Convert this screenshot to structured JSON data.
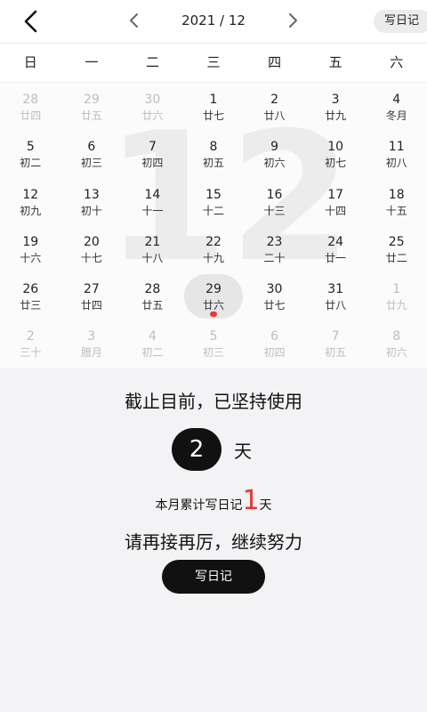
{
  "header": {
    "month_title": "2021 / 12",
    "write_diary_label": "写日记"
  },
  "weekdays": [
    "日",
    "一",
    "二",
    "三",
    "四",
    "五",
    "六"
  ],
  "calendar": {
    "background_number": "12",
    "days": [
      {
        "d": "28",
        "l": "廿四",
        "other": true
      },
      {
        "d": "29",
        "l": "廿五",
        "other": true
      },
      {
        "d": "30",
        "l": "廿六",
        "other": true
      },
      {
        "d": "1",
        "l": "廿七"
      },
      {
        "d": "2",
        "l": "廿八"
      },
      {
        "d": "3",
        "l": "廿九"
      },
      {
        "d": "4",
        "l": "冬月"
      },
      {
        "d": "5",
        "l": "初二"
      },
      {
        "d": "6",
        "l": "初三"
      },
      {
        "d": "7",
        "l": "初四"
      },
      {
        "d": "8",
        "l": "初五"
      },
      {
        "d": "9",
        "l": "初六"
      },
      {
        "d": "10",
        "l": "初七"
      },
      {
        "d": "11",
        "l": "初八"
      },
      {
        "d": "12",
        "l": "初九"
      },
      {
        "d": "13",
        "l": "初十"
      },
      {
        "d": "14",
        "l": "十一"
      },
      {
        "d": "15",
        "l": "十二"
      },
      {
        "d": "16",
        "l": "十三"
      },
      {
        "d": "17",
        "l": "十四"
      },
      {
        "d": "18",
        "l": "十五"
      },
      {
        "d": "19",
        "l": "十六"
      },
      {
        "d": "20",
        "l": "十七"
      },
      {
        "d": "21",
        "l": "十八"
      },
      {
        "d": "22",
        "l": "十九"
      },
      {
        "d": "23",
        "l": "二十"
      },
      {
        "d": "24",
        "l": "廿一"
      },
      {
        "d": "25",
        "l": "廿二"
      },
      {
        "d": "26",
        "l": "廿三"
      },
      {
        "d": "27",
        "l": "廿四"
      },
      {
        "d": "28",
        "l": "廿五"
      },
      {
        "d": "29",
        "l": "廿六",
        "selected": true,
        "dot": true
      },
      {
        "d": "30",
        "l": "廿七"
      },
      {
        "d": "31",
        "l": "廿八"
      },
      {
        "d": "1",
        "l": "廿九",
        "other": true
      },
      {
        "d": "2",
        "l": "三十",
        "other": true
      },
      {
        "d": "3",
        "l": "腊月",
        "other": true
      },
      {
        "d": "4",
        "l": "初二",
        "other": true
      },
      {
        "d": "5",
        "l": "初三",
        "other": true
      },
      {
        "d": "6",
        "l": "初四",
        "other": true
      },
      {
        "d": "7",
        "l": "初五",
        "other": true
      },
      {
        "d": "8",
        "l": "初六",
        "other": true
      }
    ]
  },
  "stats": {
    "persist_text": "截止目前，已坚持使用",
    "days_count": "2",
    "days_unit": "天",
    "month_label": "本月累计写日记",
    "month_count": "1",
    "month_unit": "天",
    "encourage_text": "请再接再厉，继续努力",
    "write_button_label": "写日记"
  },
  "colors": {
    "accent_red": "#e53935",
    "dark": "#111111",
    "selected_bg": "#e6e6e6"
  }
}
